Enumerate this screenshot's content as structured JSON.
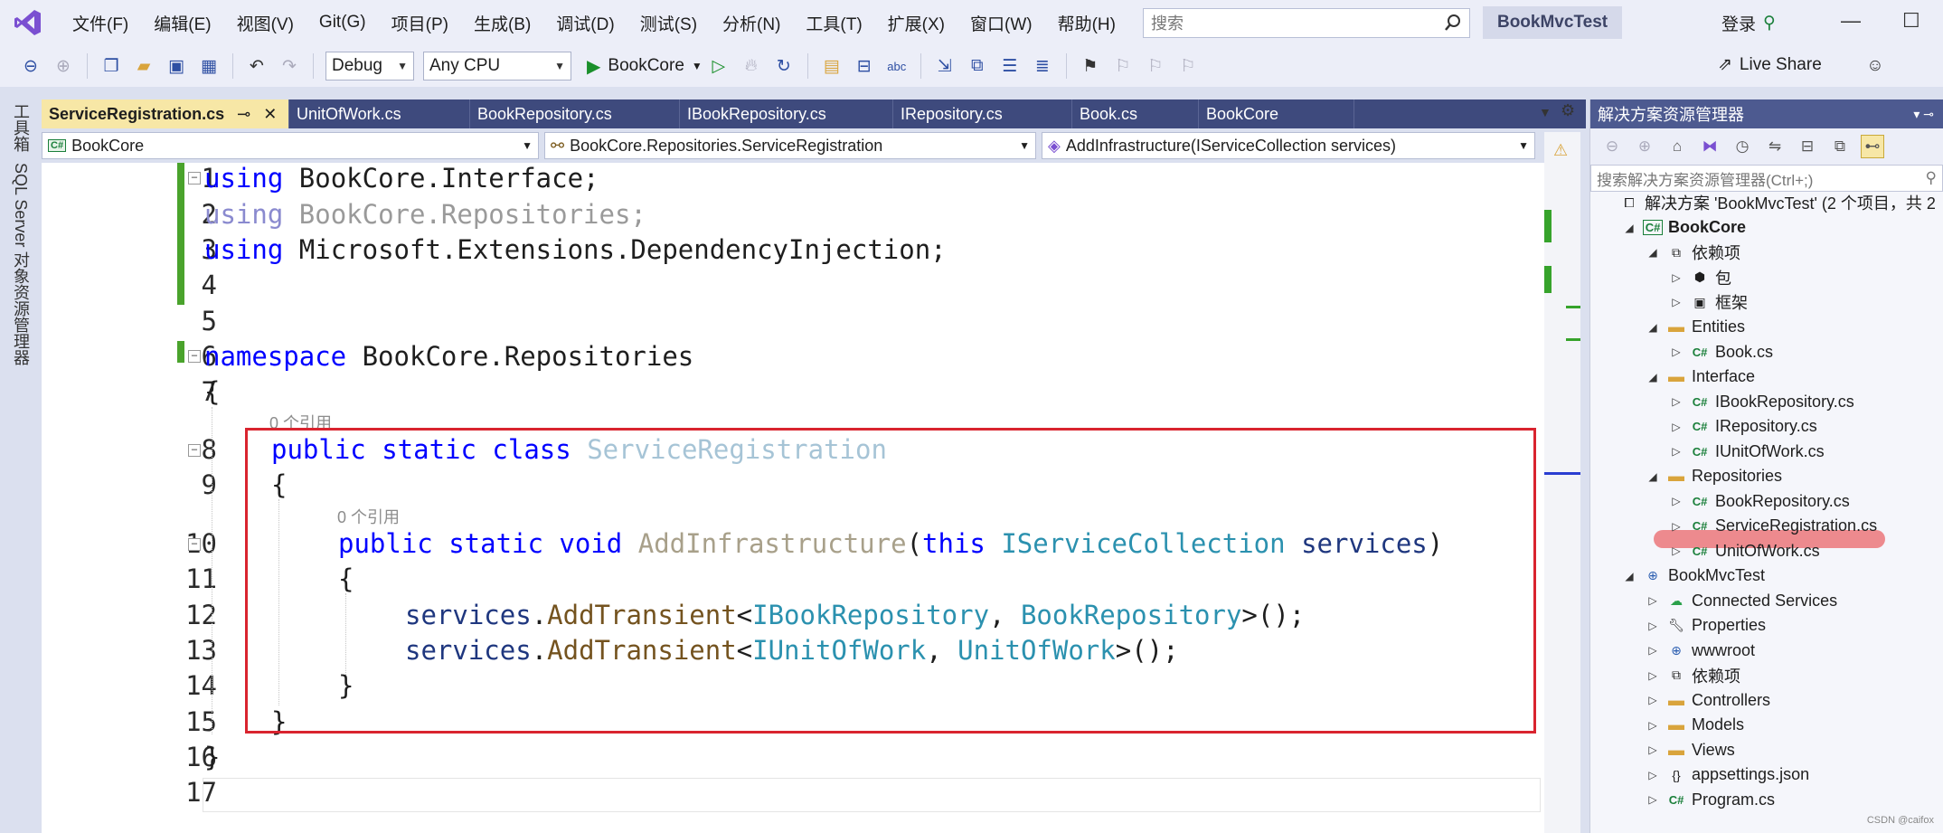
{
  "menu": {
    "items": [
      "文件(F)",
      "编辑(E)",
      "视图(V)",
      "Git(G)",
      "项目(P)",
      "生成(B)",
      "调试(D)",
      "测试(S)",
      "分析(N)",
      "工具(T)",
      "扩展(X)",
      "窗口(W)",
      "帮助(H)"
    ],
    "search_placeholder": "搜索",
    "solution_title": "BookMvcTest",
    "login": "登录"
  },
  "toolbar": {
    "config": "Debug",
    "platform": "Any CPU",
    "start_label": "BookCore",
    "live_share": "Live Share"
  },
  "left_tabs": [
    "工具箱",
    "SQL Server 对象资源管理器"
  ],
  "tabs": [
    "ServiceRegistration.cs",
    "UnitOfWork.cs",
    "BookRepository.cs",
    "IBookRepository.cs",
    "IRepository.cs",
    "Book.cs",
    "BookCore"
  ],
  "nav": {
    "project": "BookCore",
    "type": "BookCore.Repositories.ServiceRegistration",
    "member": "AddInfrastructure(IServiceCollection services)"
  },
  "code": {
    "line_numbers": [
      "1",
      "2",
      "3",
      "4",
      "5",
      "6",
      "7",
      "8",
      "9",
      "10",
      "11",
      "12",
      "13",
      "14",
      "15",
      "16",
      "17"
    ],
    "codelens_class": "0 个引用",
    "codelens_method": "0 个引用",
    "l1_kw": "using",
    "l1_rest": " BookCore.Interface;",
    "l2_kw": "using",
    "l2_rest": " BookCore.Repositories;",
    "l3_kw": "using",
    "l3_rest": " Microsoft.Extensions.DependencyInjection;",
    "l6_kw": "namespace",
    "l6_rest": " BookCore.Repositories",
    "l7": "{",
    "l8_kw": "public static class",
    "l8_name": " ServiceRegistration",
    "l9": "{",
    "l10_kw": "public static void",
    "l10_name": " AddInfrastructure",
    "l10_p1": "(",
    "l10_this": "this",
    "l10_type": " IServiceCollection",
    "l10_param": " services",
    "l10_p2": ")",
    "l11": "{",
    "l12_obj": "services",
    "l12_dot": ".",
    "l12_meth": "AddTransient",
    "l12_lt": "<",
    "l12_t1": "IBookRepository",
    "l12_comma": ", ",
    "l12_t2": "BookRepository",
    "l12_end": ">();",
    "l13_obj": "services",
    "l13_dot": ".",
    "l13_meth": "AddTransient",
    "l13_lt": "<",
    "l13_t1": "IUnitOfWork",
    "l13_comma": ", ",
    "l13_t2": "UnitOfWork",
    "l13_end": ">();",
    "l14": "}",
    "l15": "}",
    "l16": "}"
  },
  "solution_explorer": {
    "title": "解决方案资源管理器",
    "search_placeholder": "搜索解决方案资源管理器(Ctrl+;)",
    "items": [
      {
        "label": "解决方案 'BookMvcTest' (2 个项目，共 2",
        "icon": "solution-icon",
        "expander": ""
      },
      {
        "label": "BookCore",
        "icon": "project-icon",
        "expander": "◢"
      },
      {
        "label": "依赖项",
        "icon": "dependencies-icon",
        "expander": "◢"
      },
      {
        "label": "包",
        "icon": "package-icon",
        "expander": "▷"
      },
      {
        "label": "框架",
        "icon": "framework-icon",
        "expander": "▷"
      },
      {
        "label": "Entities",
        "icon": "folder-icon",
        "expander": "◢"
      },
      {
        "label": "Book.cs",
        "icon": "csharp-file-icon",
        "expander": "▷"
      },
      {
        "label": "Interface",
        "icon": "folder-icon",
        "expander": "◢"
      },
      {
        "label": "IBookRepository.cs",
        "icon": "csharp-file-icon",
        "expander": "▷"
      },
      {
        "label": "IRepository.cs",
        "icon": "csharp-file-icon",
        "expander": "▷"
      },
      {
        "label": "IUnitOfWork.cs",
        "icon": "csharp-file-icon",
        "expander": "▷"
      },
      {
        "label": "Repositories",
        "icon": "folder-icon",
        "expander": "◢"
      },
      {
        "label": "BookRepository.cs",
        "icon": "csharp-file-icon",
        "expander": "▷"
      },
      {
        "label": "ServiceRegistration.cs",
        "icon": "csharp-file-icon",
        "expander": "▷"
      },
      {
        "label": "UnitOfWork.cs",
        "icon": "csharp-file-icon",
        "expander": "▷"
      },
      {
        "label": "BookMvcTest",
        "icon": "web-project-icon",
        "expander": "◢"
      },
      {
        "label": "Connected Services",
        "icon": "connected-services-icon",
        "expander": "▷"
      },
      {
        "label": "Properties",
        "icon": "properties-icon",
        "expander": "▷"
      },
      {
        "label": "wwwroot",
        "icon": "globe-icon",
        "expander": "▷"
      },
      {
        "label": "依赖项",
        "icon": "dependencies-icon",
        "expander": "▷"
      },
      {
        "label": "Controllers",
        "icon": "folder-icon",
        "expander": "▷"
      },
      {
        "label": "Models",
        "icon": "folder-icon",
        "expander": "▷"
      },
      {
        "label": "Views",
        "icon": "folder-icon",
        "expander": "▷"
      },
      {
        "label": "appsettings.json",
        "icon": "json-file-icon",
        "expander": "▷"
      },
      {
        "label": "Program.cs",
        "icon": "csharp-file-icon",
        "expander": "▷"
      }
    ]
  },
  "watermark": "CSDN @caifox",
  "colors": {
    "active_tab": "#f7e7a6",
    "tab_strip": "#3e4a7d",
    "highlight_box": "#d9242f",
    "selection_highlight": "#ec7e82",
    "change_bar": "#4aa32c"
  }
}
